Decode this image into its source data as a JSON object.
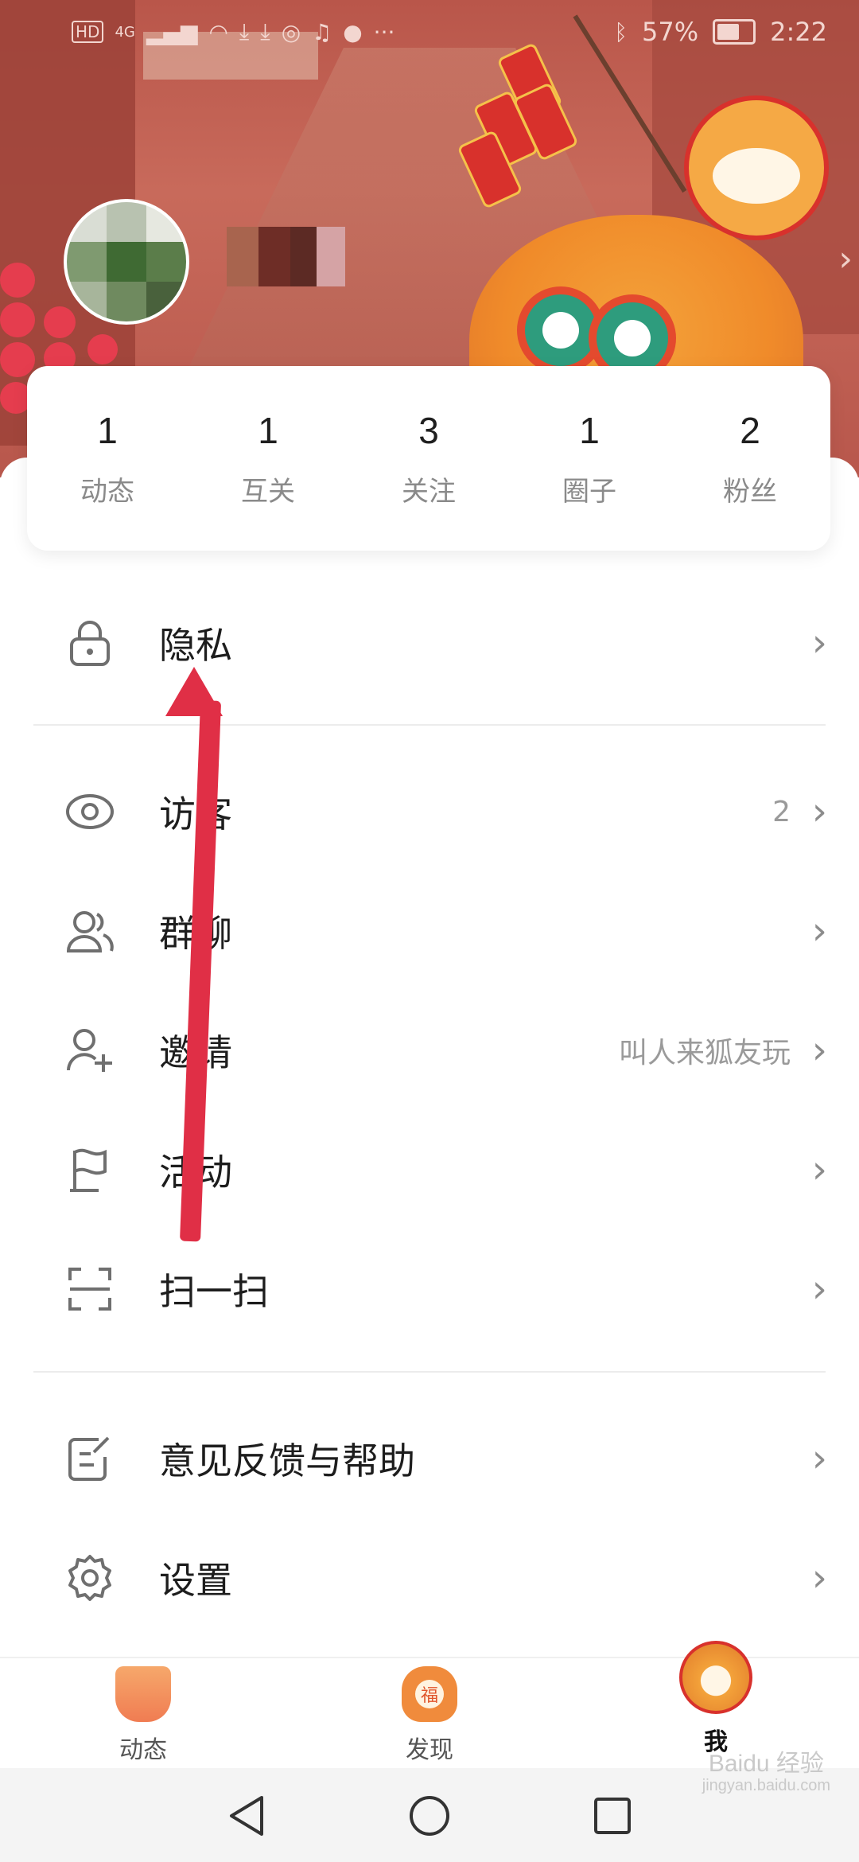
{
  "status_bar": {
    "left_icons": [
      "hd-icon",
      "4g-icon",
      "signal-icon",
      "wifi-icon",
      "download-icon",
      "download-icon",
      "nfc-icon",
      "music-icon",
      "qq-icon",
      "more-icon"
    ],
    "battery": "57%",
    "time": "2:22",
    "hd": "HD",
    "network": "4G"
  },
  "stats": [
    {
      "value": "1",
      "label": "动态"
    },
    {
      "value": "1",
      "label": "互关"
    },
    {
      "value": "3",
      "label": "关注"
    },
    {
      "value": "1",
      "label": "圈子"
    },
    {
      "value": "2",
      "label": "粉丝"
    }
  ],
  "menu": {
    "privacy": {
      "label": "隐私",
      "icon": "lock-icon"
    },
    "visitors": {
      "label": "访客",
      "extra": "2",
      "icon": "eye-icon"
    },
    "group_chat": {
      "label": "群聊",
      "icon": "group-icon"
    },
    "invite": {
      "label": "邀请",
      "extra": "叫人来狐友玩",
      "icon": "add-user-icon"
    },
    "activity": {
      "label": "活动",
      "icon": "flag-icon"
    },
    "scan": {
      "label": "扫一扫",
      "icon": "scan-icon"
    },
    "feedback": {
      "label": "意见反馈与帮助",
      "icon": "edit-icon"
    },
    "settings": {
      "label": "设置",
      "icon": "gear-icon"
    },
    "chevron": "›"
  },
  "tabbar": {
    "feed": "动态",
    "discover": "发现",
    "me": "我",
    "discover_badge": "福"
  },
  "watermark": {
    "line1": "Baidu 经验",
    "line2": "jingyan.baidu.com"
  },
  "colors": {
    "accent_red": "#e02f46",
    "header_bg": "#b9564a",
    "text_primary": "#1d1d1d",
    "text_secondary": "#8a8a8a"
  }
}
